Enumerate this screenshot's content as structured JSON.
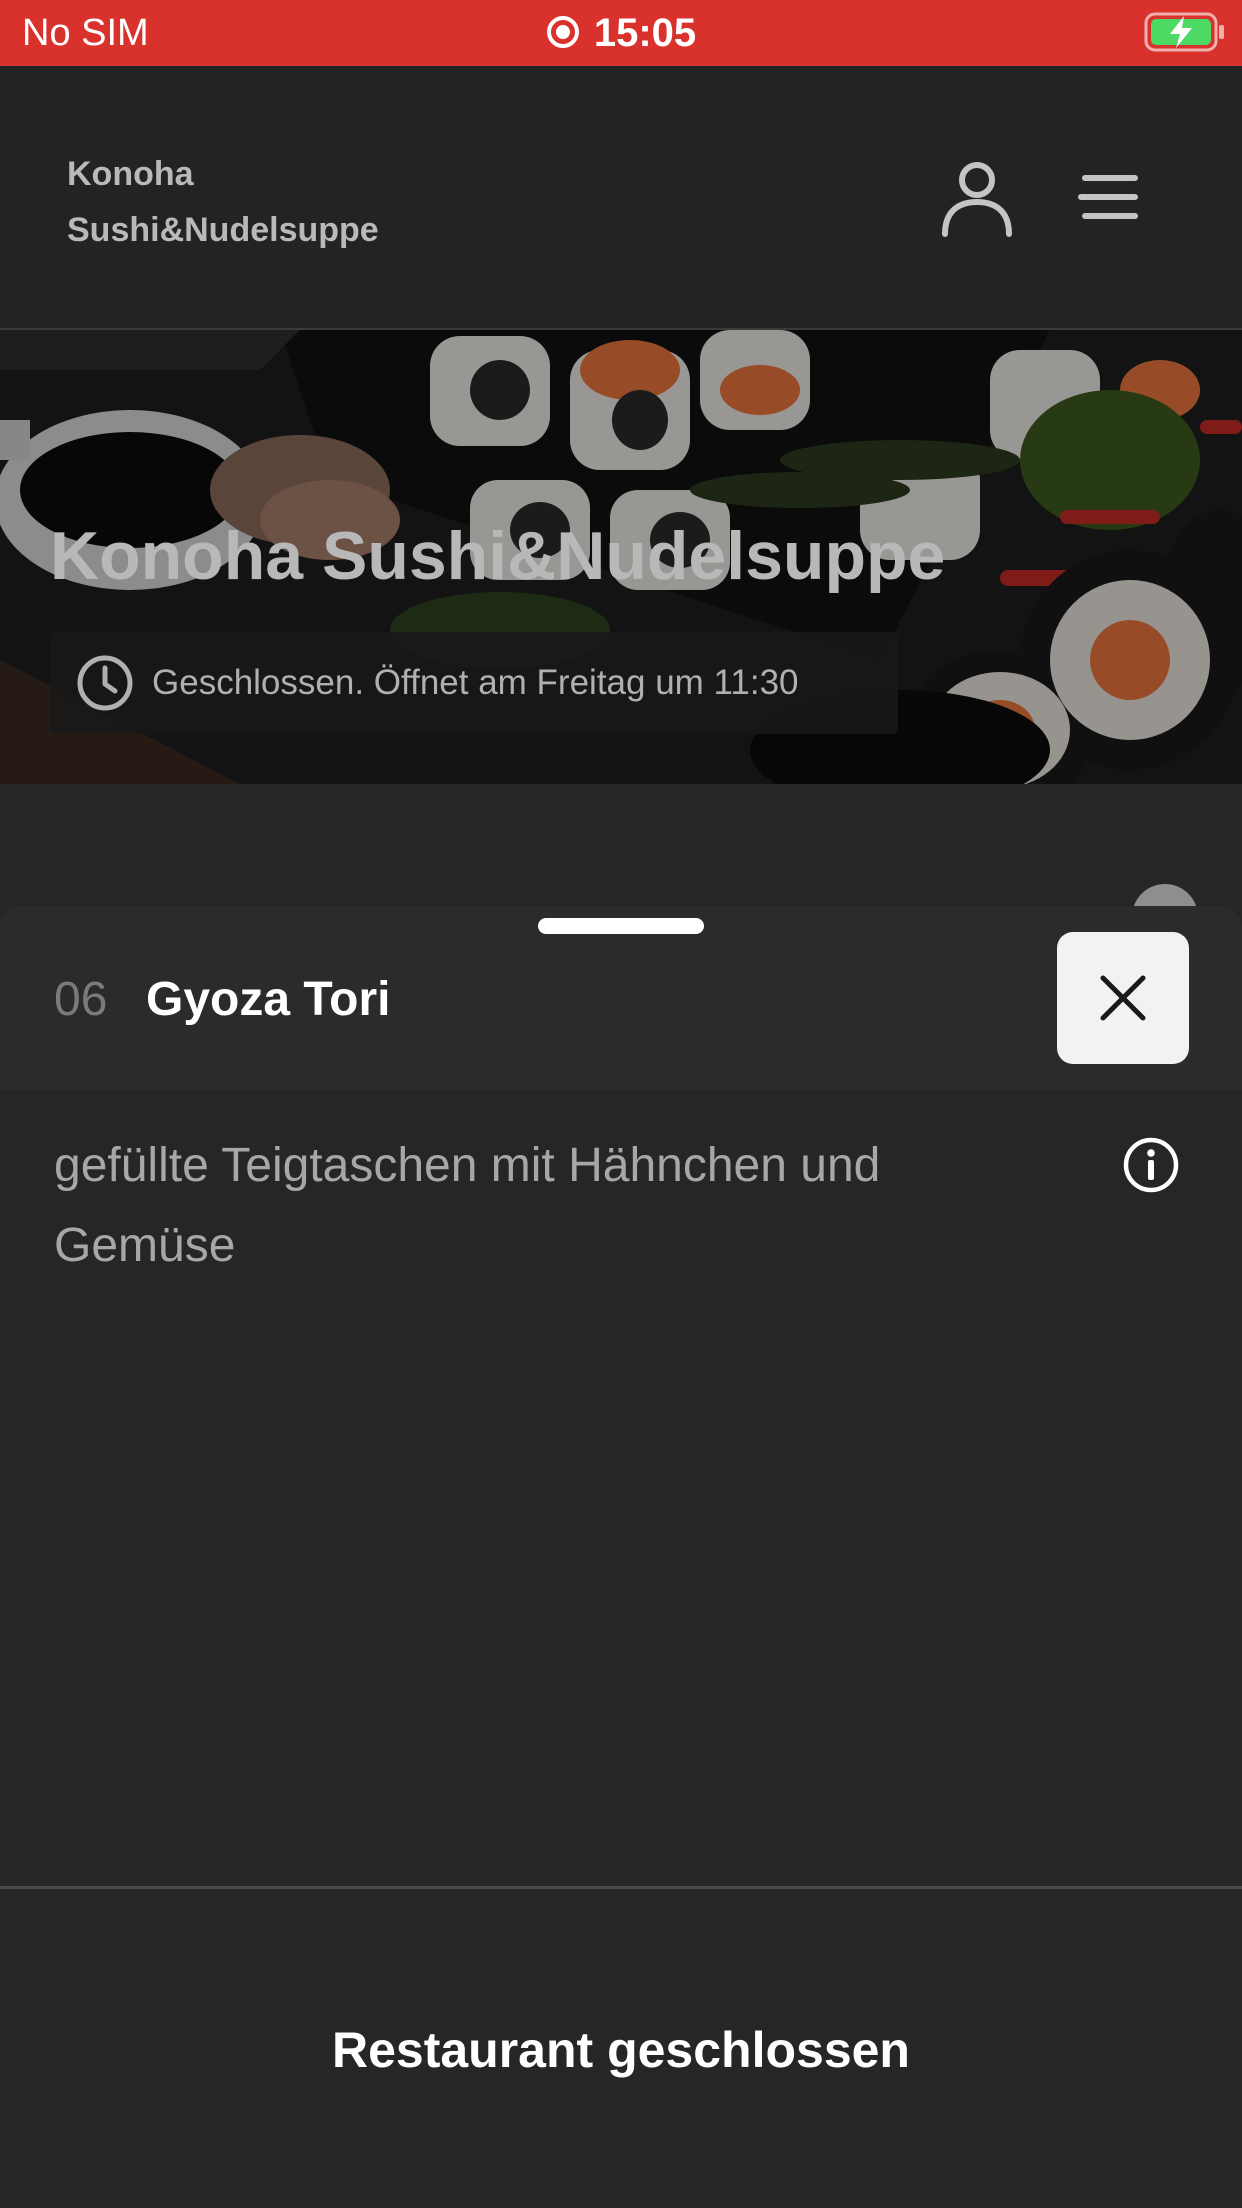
{
  "status_bar": {
    "carrier": "No SIM",
    "time": "15:05",
    "background_color": "#d9322c",
    "battery_color": "#4cd964",
    "icons": [
      "screen-recording-icon",
      "battery-charging-icon"
    ]
  },
  "header": {
    "restaurant_name_line1": "Konoha",
    "restaurant_name_line2": "Sushi&Nudelsuppe",
    "icons": [
      "user-icon",
      "hamburger-menu-icon"
    ]
  },
  "hero": {
    "title": "Konoha Sushi&Nudelsuppe",
    "opening_status": "Geschlossen. Öffnet am Freitag um 11:30",
    "icon": "clock-icon"
  },
  "item_sheet": {
    "number": "06",
    "name": "Gyoza Tori",
    "description": "gefüllte Teigtaschen mit Hähnchen und Gemüse",
    "icons": [
      "close-icon",
      "info-icon"
    ]
  },
  "footer": {
    "label": "Restaurant geschlossen"
  }
}
